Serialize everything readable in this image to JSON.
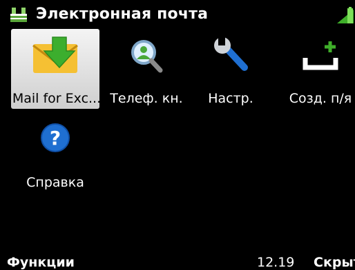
{
  "status": {
    "title": "Электронная почта",
    "app_icon": "mailbox-icon",
    "battery_icon": "battery-icon"
  },
  "apps": [
    {
      "label": "Mail for Exc...",
      "icon": "mail-download-icon",
      "selected": true
    },
    {
      "label": "Телеф. кн.",
      "icon": "contacts-search-icon",
      "selected": false
    },
    {
      "label": "Настр.",
      "icon": "wrench-icon",
      "selected": false
    },
    {
      "label": "Созд. п/я",
      "icon": "new-mailbox-icon",
      "selected": false
    },
    {
      "label": "Справка",
      "icon": "help-icon",
      "selected": false
    }
  ],
  "softkeys": {
    "left": "Функции",
    "clock": "12.19",
    "right": "Скрыть"
  },
  "colors": {
    "background": "#000000",
    "selected_tile": "#e6e6e6",
    "accent_green": "#3fae2a",
    "help_blue": "#1f6fd1"
  }
}
